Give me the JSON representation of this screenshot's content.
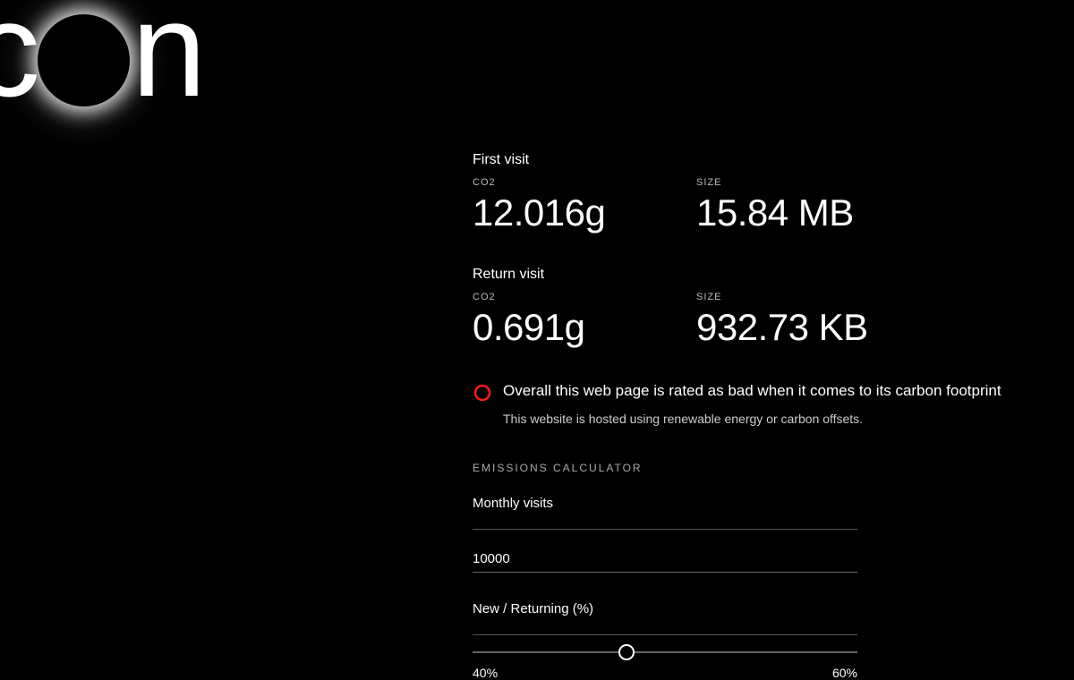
{
  "logo": {
    "text_left": "c",
    "text_right": "n"
  },
  "first_visit": {
    "heading": "First visit",
    "co2_label": "CO2",
    "co2_value": "12.016g",
    "size_label": "SIZE",
    "size_value": "15.84 MB"
  },
  "return_visit": {
    "heading": "Return visit",
    "co2_label": "CO2",
    "co2_value": "0.691g",
    "size_label": "SIZE",
    "size_value": "932.73 KB"
  },
  "rating": {
    "icon_color": "#ff1a1a",
    "text": "Overall this web page is rated as bad when it comes to its carbon footprint",
    "hosting_note": "This website is hosted using renewable energy or carbon offsets."
  },
  "calculator": {
    "title": "EMISSIONS CALCULATOR",
    "monthly_visits_label": "Monthly visits",
    "monthly_visits_value": "10000",
    "ratio_label": "New / Returning (%)",
    "slider_left": "40%",
    "slider_right": "60%",
    "slider_position_percent": 40
  }
}
